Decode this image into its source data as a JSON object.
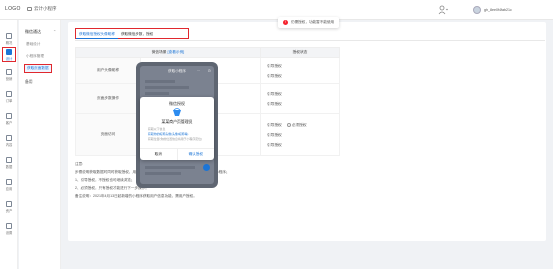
{
  "header": {
    "logo": "LOGO",
    "app_name": "云计小程序",
    "toast": "仍需授权，功能暂不能使用",
    "user_name": "gh_8ee0f4fab21c"
  },
  "rail": {
    "items": [
      {
        "label": "概况",
        "icon": "home-icon"
      },
      {
        "label": "设计",
        "icon": "design-icon",
        "active": true
      },
      {
        "label": "营销",
        "icon": "marketing-icon"
      },
      {
        "label": "订单",
        "icon": "order-icon"
      },
      {
        "label": "客户",
        "icon": "customer-icon"
      },
      {
        "label": "内容",
        "icon": "content-icon"
      },
      {
        "label": "数据",
        "icon": "data-icon"
      },
      {
        "label": "应用",
        "icon": "app-icon"
      },
      {
        "label": "资产",
        "icon": "asset-icon"
      },
      {
        "label": "设置",
        "icon": "settings-icon"
      }
    ]
  },
  "subnav": {
    "group": "微信通达",
    "items": [
      {
        "label": "基础设计"
      },
      {
        "label": "小程序管理"
      },
      {
        "label": "获取页面数据",
        "active": true
      }
    ],
    "bottom": "备用"
  },
  "tabs": [
    {
      "label": "获取微信授权头像昵称",
      "active": true
    },
    {
      "label": "获取微信步数，授权"
    }
  ],
  "table": {
    "col1": "微信场景",
    "col1_link": "[查看示例]",
    "col2": "授权状态",
    "rows": [
      {
        "name": "用户头像昵称",
        "status": [
          "引导授权",
          "引导授权"
        ]
      },
      {
        "name": "页面步数操作",
        "status": [
          "引导授权",
          "引导授权"
        ]
      },
      {
        "name": "页面访问",
        "status": [
          "引导授权",
          "引导授权",
          "引导授权"
        ],
        "radio_label": "必须授权"
      }
    ]
  },
  "notes": {
    "lines": [
      "注意:",
      "步骤说明获取数据时同时获取授权，用户可自由选择是否同意授权，用户未授权时可浏览小程序；",
      "1、引导授权，不授权也可继续浏览；",
      "2、必须授权，只有授权才能进行下一步操作。",
      "备注说明：2021年4月13日起新增的小程序获取用户信息功能，需用户授权。"
    ]
  },
  "phone": {
    "title": "获取小程序",
    "time": "···",
    "dialog": {
      "title": "微信授权",
      "app_name": "某某商户页管理员",
      "lines": [
        "获取以下信息",
        "获取你的昵称头像(头像/昵称等)",
        "获取位置(你的位置信息将用于小程序定位)"
      ],
      "cancel": "取消",
      "confirm": "确认授权"
    }
  }
}
